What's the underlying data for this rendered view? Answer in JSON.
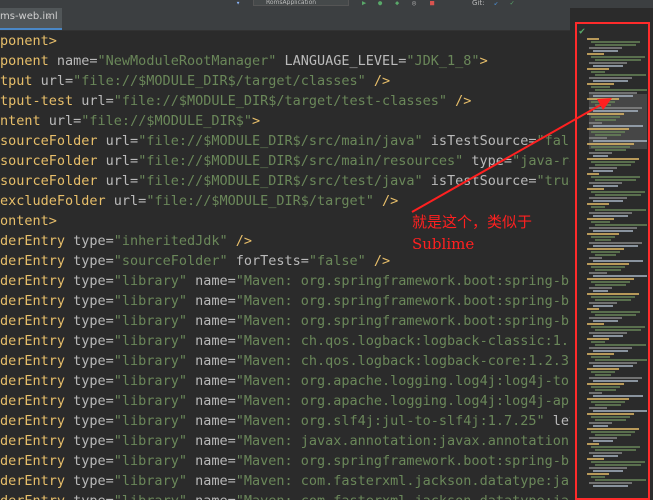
{
  "window": {
    "tab_title": "ms-web.iml",
    "tab_close_glyph": "×",
    "run_config": "RomsApplication",
    "toolbar_fragment": "Git:"
  },
  "colors": {
    "background": "#2b2b2b",
    "tag": "#e8bf6a",
    "attribute": "#bababa",
    "string": "#6a8759",
    "annotation": "#ff2020"
  },
  "code_lines": [
    [
      [
        "t",
        "ponent>"
      ]
    ],
    [
      [
        "t",
        "ponent "
      ],
      [
        "a",
        "name="
      ],
      [
        "v",
        "\"NewModuleRootManager\""
      ],
      [
        "a",
        " LANGUAGE_LEVEL="
      ],
      [
        "v",
        "\"JDK_1_8\""
      ],
      [
        "t",
        ">"
      ]
    ],
    [
      [
        "t",
        "tput "
      ],
      [
        "a",
        "url="
      ],
      [
        "v",
        "\"file://$MODULE_DIR$/target/classes\""
      ],
      [
        "t",
        " />"
      ]
    ],
    [
      [
        "t",
        "tput-test "
      ],
      [
        "a",
        "url="
      ],
      [
        "v",
        "\"file://$MODULE_DIR$/target/test-classes\""
      ],
      [
        "t",
        " />"
      ]
    ],
    [
      [
        "t",
        "ntent "
      ],
      [
        "a",
        "url="
      ],
      [
        "v",
        "\"file://$MODULE_DIR$\""
      ],
      [
        "t",
        ">"
      ]
    ],
    [
      [
        "t",
        "sourceFolder "
      ],
      [
        "a",
        "url="
      ],
      [
        "v",
        "\"file://$MODULE_DIR$/src/main/java\""
      ],
      [
        "a",
        " isTestSource="
      ],
      [
        "v",
        "\"false\""
      ],
      [
        "t",
        " />"
      ]
    ],
    [
      [
        "t",
        "sourceFolder "
      ],
      [
        "a",
        "url="
      ],
      [
        "v",
        "\"file://$MODULE_DIR$/src/main/resources\""
      ],
      [
        "a",
        " type="
      ],
      [
        "v",
        "\"java-resource"
      ]
    ],
    [
      [
        "t",
        "sourceFolder "
      ],
      [
        "a",
        "url="
      ],
      [
        "v",
        "\"file://$MODULE_DIR$/src/test/java\""
      ],
      [
        "a",
        " isTestSource="
      ],
      [
        "v",
        "\"true\""
      ],
      [
        "t",
        " />"
      ]
    ],
    [
      [
        "t",
        "excludeFolder "
      ],
      [
        "a",
        "url="
      ],
      [
        "v",
        "\"file://$MODULE_DIR$/target\""
      ],
      [
        "t",
        " />"
      ]
    ],
    [
      [
        "t",
        "ontent>"
      ]
    ],
    [
      [
        "t",
        "derEntry "
      ],
      [
        "a",
        "type="
      ],
      [
        "v",
        "\"inheritedJdk\""
      ],
      [
        "t",
        " />"
      ]
    ],
    [
      [
        "t",
        "derEntry "
      ],
      [
        "a",
        "type="
      ],
      [
        "v",
        "\"sourceFolder\""
      ],
      [
        "a",
        " forTests="
      ],
      [
        "v",
        "\"false\""
      ],
      [
        "t",
        " />"
      ]
    ],
    [
      [
        "t",
        "derEntry "
      ],
      [
        "a",
        "type="
      ],
      [
        "v",
        "\"library\""
      ],
      [
        "a",
        " name="
      ],
      [
        "v",
        "\"Maven: org.springframework.boot:spring-boot-sta"
      ]
    ],
    [
      [
        "t",
        "derEntry "
      ],
      [
        "a",
        "type="
      ],
      [
        "v",
        "\"library\""
      ],
      [
        "a",
        " name="
      ],
      [
        "v",
        "\"Maven: org.springframework.boot:spring-boot-sta"
      ]
    ],
    [
      [
        "t",
        "derEntry "
      ],
      [
        "a",
        "type="
      ],
      [
        "v",
        "\"library\""
      ],
      [
        "a",
        " name="
      ],
      [
        "v",
        "\"Maven: org.springframework.boot:spring-boot-sta"
      ]
    ],
    [
      [
        "t",
        "derEntry "
      ],
      [
        "a",
        "type="
      ],
      [
        "v",
        "\"library\""
      ],
      [
        "a",
        " name="
      ],
      [
        "v",
        "\"Maven: ch.qos.logback:logback-classic:1.2.3\""
      ],
      [
        "a",
        " le"
      ]
    ],
    [
      [
        "t",
        "derEntry "
      ],
      [
        "a",
        "type="
      ],
      [
        "v",
        "\"library\""
      ],
      [
        "a",
        " name="
      ],
      [
        "v",
        "\"Maven: ch.qos.logback:logback-core:1.2.3\""
      ],
      [
        "a",
        " level"
      ]
    ],
    [
      [
        "t",
        "derEntry "
      ],
      [
        "a",
        "type="
      ],
      [
        "v",
        "\"library\""
      ],
      [
        "a",
        " name="
      ],
      [
        "v",
        "\"Maven: org.apache.logging.log4j:log4j-to-slf4j:"
      ]
    ],
    [
      [
        "t",
        "derEntry "
      ],
      [
        "a",
        "type="
      ],
      [
        "v",
        "\"library\""
      ],
      [
        "a",
        " name="
      ],
      [
        "v",
        "\"Maven: org.apache.logging.log4j:log4j-api:2.10."
      ]
    ],
    [
      [
        "t",
        "derEntry "
      ],
      [
        "a",
        "type="
      ],
      [
        "v",
        "\"library\""
      ],
      [
        "a",
        " name="
      ],
      [
        "v",
        "\"Maven: org.slf4j:jul-to-slf4j:1.7.25\""
      ],
      [
        "a",
        " level="
      ],
      [
        "v",
        "\"pr"
      ]
    ],
    [
      [
        "t",
        "derEntry "
      ],
      [
        "a",
        "type="
      ],
      [
        "v",
        "\"library\""
      ],
      [
        "a",
        " name="
      ],
      [
        "v",
        "\"Maven: javax.annotation:javax.annotation-api:1."
      ]
    ],
    [
      [
        "t",
        "derEntry "
      ],
      [
        "a",
        "type="
      ],
      [
        "v",
        "\"library\""
      ],
      [
        "a",
        " name="
      ],
      [
        "v",
        "\"Maven: org.springframework.boot:spring-boot-sta"
      ]
    ],
    [
      [
        "t",
        "derEntry "
      ],
      [
        "a",
        "type="
      ],
      [
        "v",
        "\"library\""
      ],
      [
        "a",
        " name="
      ],
      [
        "v",
        "\"Maven: com.fasterxml.jackson.datatype:jackson-d"
      ]
    ],
    [
      [
        "t",
        "derEntry "
      ],
      [
        "a",
        "type="
      ],
      [
        "v",
        "\"library\""
      ],
      [
        "a",
        " name="
      ],
      [
        "v",
        "\"Maven: com.fasterxml.jackson.datatype:jackson-d"
      ]
    ]
  ],
  "annotation": {
    "line1": "就是这个，类似于",
    "line2": "Sublime"
  },
  "minimap": {
    "status_icon": "check-icon"
  }
}
